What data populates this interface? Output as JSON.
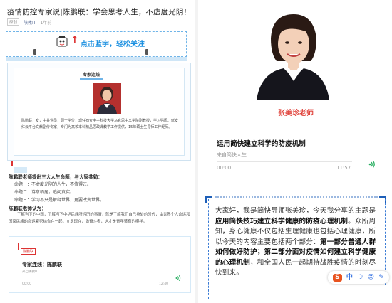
{
  "article": {
    "title": "疫情防控专家说|陈鹏联：学会思考人生，不虚度光阴！",
    "original_badge": "原创",
    "account": "陕教IT",
    "date": "1年前"
  },
  "follow_banner": {
    "text": "点击蓝字，轻松关注"
  },
  "profile": {
    "tag": "专家连线",
    "bio": "陈鹏联，女，中共党员，硕士学位，现任西安电子科技大学马克思主义学院副教授，学习强国、延安红云平台文献副传专家，专门为高校本科精品思政课教学工作提供，15年硕士生导师工作经历。"
  },
  "section": {
    "heading": "陈鹏联老师提出三大人生命题，与大家共勉：",
    "lines": [
      "命题一：不虚度光阴的人生，不值得过。",
      "命题二：诗意栖居，追问真实。",
      "命题三：学习不只是解释世界，更要改变世界。"
    ],
    "heading2": "陈鹏联老师认为：",
    "para": "了解当下的中国，了解当下中华民族所经历的事情，就是了解我们自己身处的时代，由世界个人命运和国家民族的命运紧密结合在一起，立足现在，做奋斗者，这才是青年该有的模样。"
  },
  "sub_audio": {
    "tag": "陈鹏联",
    "title": "专家连线：陈鹏联",
    "source": "来自陕教IT",
    "t0": "00:00",
    "t1": "12:40"
  },
  "right": {
    "name": "张美珍老师",
    "audio_title": "运用简快建立科学的防疫机制",
    "audio_source": "来自简快人生",
    "t0": "00:00",
    "t1": "11:57",
    "quote_plain_1": "大家好，我是简快导师张美珍，今天我分享的主题是",
    "quote_bold_1": "应用简快技巧建立科学健康的防疫心理机制",
    "quote_plain_2": "。众所周知，身心健康不仅包括生理健康也包括心理健康，所以今天的内容主要包括两个部分：",
    "quote_bold_2": "第一部分普通人群如何做好防护；第二部分面对疫情如何建立科学健康的心理机制",
    "quote_plain_3": "，和全国人民一起期待战胜疫情的时刻尽快到来。"
  },
  "toolbar": {
    "s_label": "S",
    "zh_label": "中",
    "moon": "☽",
    "smile": "☺",
    "pen": "✎"
  },
  "colors": {
    "accent_blue": "#1a8fe0",
    "name_red": "#e0433b",
    "play_green": "#27ae60"
  }
}
